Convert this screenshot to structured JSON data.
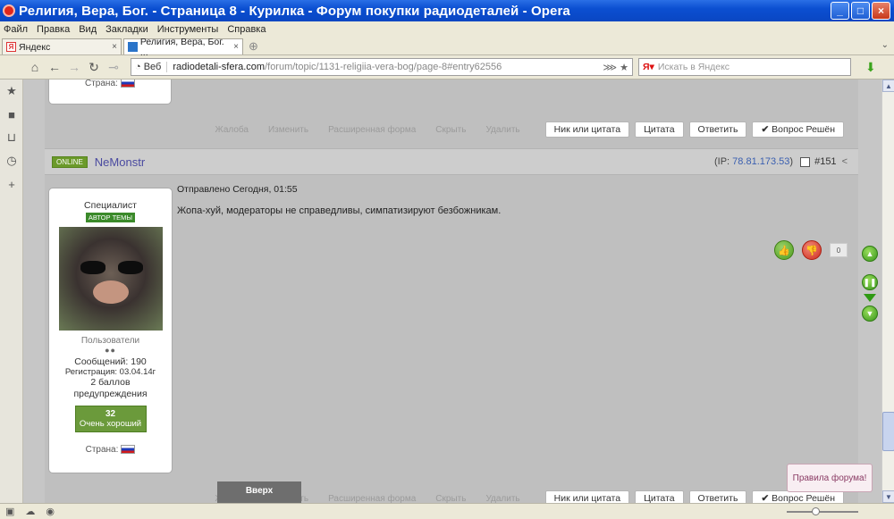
{
  "window": {
    "title": "Религия, Вера, Бог. - Страница 8 - Курилка - Форум покупки радиодеталей - Opera",
    "buttons": {
      "minimize": "_",
      "maximize": "□",
      "close": "×"
    }
  },
  "menu": [
    "Файл",
    "Правка",
    "Вид",
    "Закладки",
    "Инструменты",
    "Справка"
  ],
  "tabs": [
    {
      "label": "Яндекс",
      "close": "×",
      "active": false
    },
    {
      "label": "Религия, Вера, Бог. ...",
      "close": "×",
      "active": true
    }
  ],
  "address": {
    "web_label": "Веб",
    "domain": "radiodetali-sfera.com",
    "path": "/forum/topic/1131-religiia-vera-bog/page-8#entry62556",
    "search_placeholder": "Искать в Яндекс"
  },
  "top_card": {
    "country_label": "Страна:"
  },
  "actions": {
    "complaint": "Жалоба",
    "edit": "Изменить",
    "extended": "Расширенная форма",
    "hide": "Скрыть",
    "delete": "Удалить",
    "nick_quote": "Ник или цитата",
    "quote": "Цитата",
    "reply": "Ответить",
    "solved": "Вопрос Решён"
  },
  "post": {
    "online_badge": "ONLINE",
    "author": "NeMonstr",
    "ip_prefix": "(IP: ",
    "ip": "78.81.173.53",
    "ip_suffix": ")",
    "number": "#151",
    "date": "Отправлено Сегодня, 01:55",
    "text": "Жопа-хуй, модераторы не справедливы, симпатизируют безбожникам.",
    "votes": "0"
  },
  "user": {
    "rank": "Специалист",
    "topic_author_badge": "АВТОР ТЕМЫ",
    "group": "Пользователи",
    "pips": "●●",
    "posts": "Сообщений: 190",
    "registered": "Регистрация: 03.04.14г",
    "warnings_line1": "2 баллов",
    "warnings_line2": "предупреждения",
    "reputation_value": "32",
    "reputation_label": "Очень хороший",
    "country_label": "Страна:"
  },
  "back_to_top": "Вверх",
  "toast": "Правила форума!",
  "colors": {
    "titlebar": "#0b4fd1",
    "online": "#6b9a2a",
    "reputation": "#6b9a3b",
    "author_link": "#4a4aa0"
  }
}
